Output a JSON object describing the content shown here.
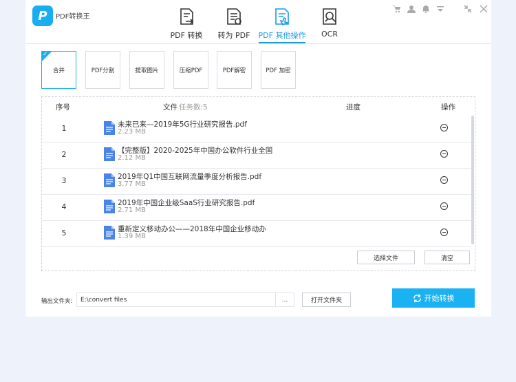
{
  "app": {
    "name": "PDF转换王",
    "logo_letter": "P",
    "accent": "#19aef0"
  },
  "tabs": [
    {
      "label": "PDF 转换",
      "icon": "pdf-convert-icon",
      "active": false
    },
    {
      "label": "转为 PDF",
      "icon": "to-pdf-icon",
      "active": false
    },
    {
      "label": "PDF 其他操作",
      "icon": "pdf-other-icon",
      "active": true
    },
    {
      "label": "OCR",
      "icon": "ocr-icon",
      "active": false
    }
  ],
  "window_controls": [
    "cart-icon",
    "user-icon",
    "bell-icon",
    "menu-icon",
    "minimize-icon",
    "close-icon"
  ],
  "tools": [
    {
      "label": "合并",
      "active": true
    },
    {
      "label": "PDF分割",
      "active": false
    },
    {
      "label": "提取图片",
      "active": false
    },
    {
      "label": "压缩PDF",
      "active": false
    },
    {
      "label": "PDF解密",
      "active": false
    },
    {
      "label": "PDF 加密",
      "active": false
    }
  ],
  "table": {
    "col_index": "序号",
    "col_file": "文件",
    "task_count": "任务数:5",
    "col_progress": "进度",
    "col_action": "操作",
    "rows": [
      {
        "num": "1",
        "name": "未来已来—2019年5G行业研究报告.pdf",
        "size": "2.23 MB"
      },
      {
        "num": "2",
        "name": "【完整版】2020-2025年中国办公软件行业全国",
        "size": "2.12 MB"
      },
      {
        "num": "3",
        "name": "2019年Q1中国互联网流量季度分析报告.pdf",
        "size": "3.77 MB"
      },
      {
        "num": "4",
        "name": "2019年中国企业级SaaS行业研究报告.pdf",
        "size": "2.71 MB"
      },
      {
        "num": "5",
        "name": "重新定义移动办公——2018年中国企业移动办",
        "size": "1.39 MB"
      }
    ]
  },
  "buttons": {
    "select_files": "选择文件",
    "clear": "清空",
    "open_folder": "打开文件夹",
    "browse": "...",
    "start": "开始转换"
  },
  "output": {
    "label": "输出文件夹:",
    "path": "E:\\convert files"
  }
}
